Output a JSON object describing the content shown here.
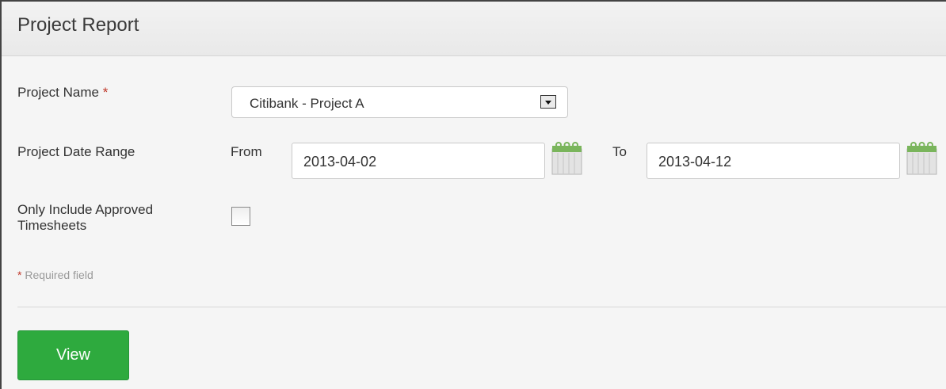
{
  "header": {
    "title": "Project Report"
  },
  "form": {
    "project_name_label": "Project Name",
    "required_mark": "*",
    "project_name_value": "Citibank - Project A",
    "date_range_label": "Project Date Range",
    "from_label": "From",
    "from_value": "2013-04-02",
    "to_label": "To",
    "to_value": "2013-04-12",
    "approved_label_line1": "Only Include Approved",
    "approved_label_line2": "Timesheets",
    "approved_checked": false,
    "required_note_mark": "*",
    "required_note_text": "Required field"
  },
  "actions": {
    "view_label": "View"
  },
  "colors": {
    "button_green": "#2eaa3e",
    "calendar_green": "#7ab55c",
    "required_red": "#c0392b"
  }
}
